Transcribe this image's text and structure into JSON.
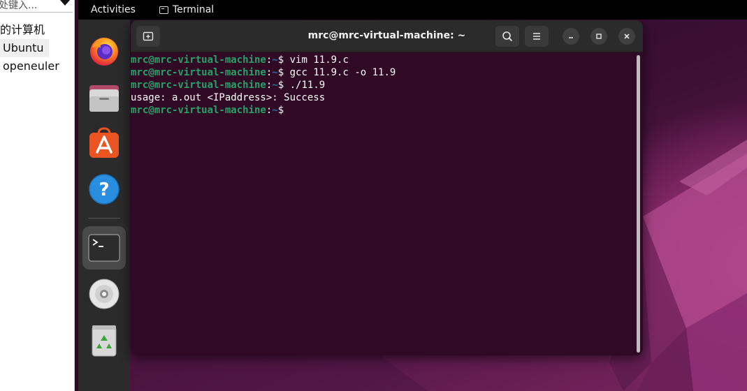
{
  "host_panel": {
    "search_text": "处键入...",
    "items": [
      "的计算机",
      "Ubuntu",
      "openeuler"
    ]
  },
  "topbar": {
    "activities": "Activities",
    "app_name": "Terminal"
  },
  "dock": {
    "items": [
      {
        "name": "firefox",
        "icon": "firefox-icon"
      },
      {
        "name": "files",
        "icon": "files-icon"
      },
      {
        "name": "app-center",
        "icon": "app-center-icon"
      },
      {
        "name": "help",
        "icon": "help-icon"
      },
      {
        "name": "terminal",
        "icon": "terminal-icon",
        "active": true
      },
      {
        "name": "dvd",
        "icon": "dvd-icon"
      },
      {
        "name": "trash",
        "icon": "trash-icon"
      }
    ]
  },
  "terminal": {
    "title": "mrc@mrc-virtual-machine: ~",
    "prompt_user": "mrc@mrc-virtual-machine",
    "prompt_sep": ":",
    "prompt_path": "~",
    "prompt_end": "$",
    "lines": [
      {
        "type": "cmd",
        "text": " vim 11.9.c"
      },
      {
        "type": "cmd",
        "text": " gcc 11.9.c -o 11.9"
      },
      {
        "type": "cmd",
        "text": " ./11.9"
      },
      {
        "type": "out",
        "text": "usage: a.out <IPaddress>: Success"
      },
      {
        "type": "cmd",
        "text": ""
      }
    ]
  },
  "colors": {
    "terminal_bg": "#300a24",
    "prompt_user": "#26a269",
    "prompt_path": "#3465a4",
    "accent": "#e95420"
  }
}
